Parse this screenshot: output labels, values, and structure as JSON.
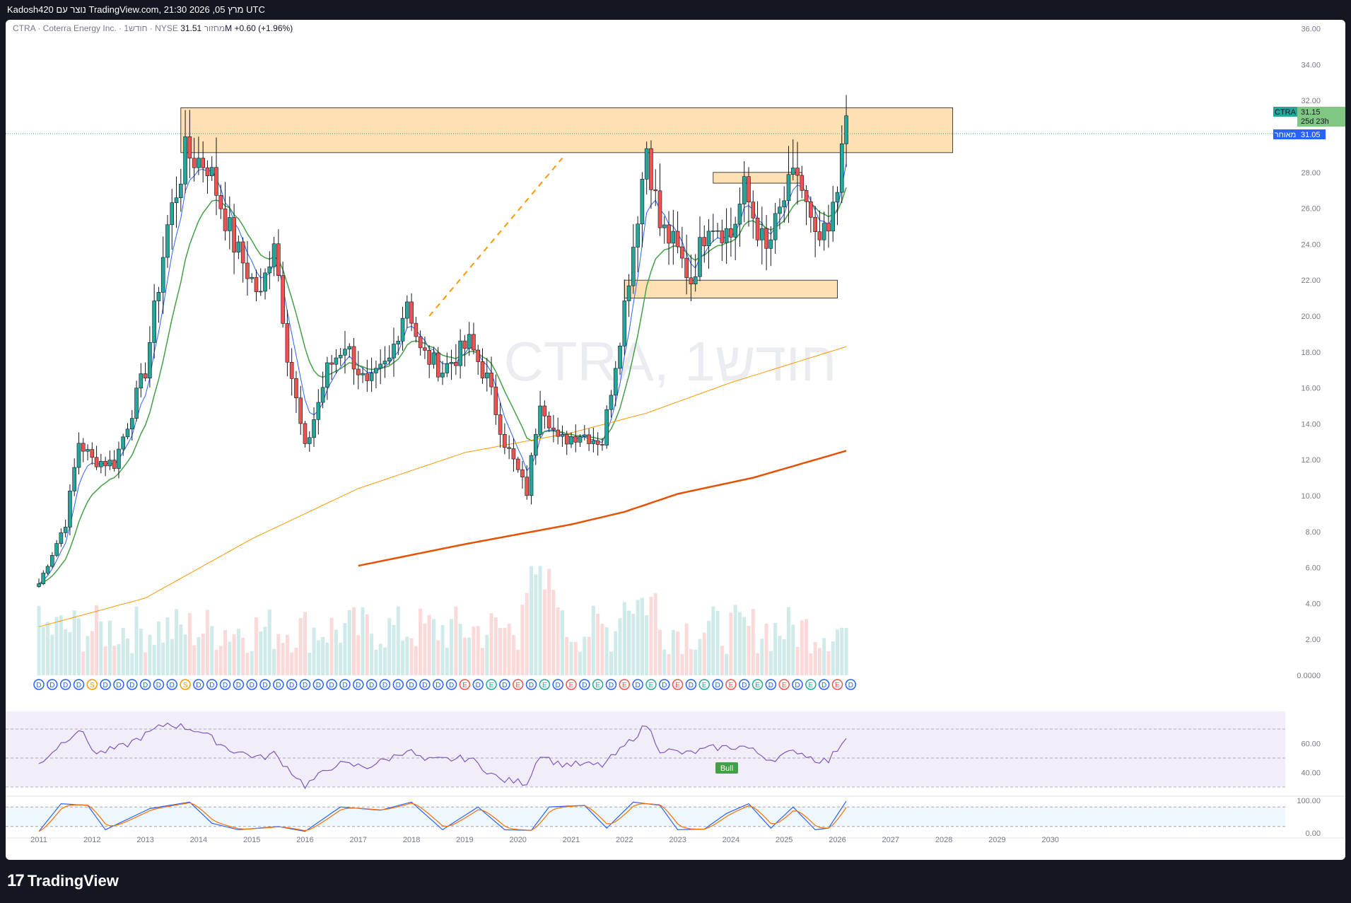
{
  "header": {
    "caption": "Kadosh420 נוצר עם TradingView.com, 21:30 2026 ,05 מרץ UTC"
  },
  "legend": {
    "symbol_line": "CTRA · Coterra Energy Inc. · 1חודש · NYSE",
    "volume_label": "מחזור",
    "volume_value": "31.51M",
    "change": "+0.60 (+1.96%)"
  },
  "watermark": "CTRA, 1חודש",
  "price_tag": {
    "symbol": "CTRA",
    "price": "31.15",
    "countdown": "25d 23h",
    "prev_label": "מאוחר",
    "prev_value": "31.05"
  },
  "rsi_label": "Bull",
  "footer": {
    "brand": "TradingView",
    "logo": "17"
  },
  "colors": {
    "up": "#26a69a",
    "down": "#ef5350",
    "zone": "#ffe0b2",
    "ema_fast": "#2962ff",
    "ema_mid": "#43a047",
    "sma_long": "#ff9800",
    "sma_200": "#e65100",
    "rsi": "#7e57c2",
    "stoch_k": "#2962ff",
    "stoch_d": "#ff6d00"
  },
  "chart_data": {
    "type": "candlestick",
    "timeframe": "1M",
    "y_axis_ticks": [
      "36.00",
      "34.00",
      "32.00",
      "30.00",
      "28.00",
      "26.00",
      "24.00",
      "22.00",
      "20.00",
      "18.00",
      "16.00",
      "14.00",
      "12.00",
      "10.00",
      "8.00",
      "6.00",
      "4.00",
      "2.00",
      "0.0000"
    ],
    "rsi_axis_ticks": [
      "60.00",
      "40.00"
    ],
    "stoch_axis_ticks": [
      "100.00",
      "0.00"
    ],
    "x_axis_ticks": [
      "2011",
      "2012",
      "2013",
      "2014",
      "2015",
      "2016",
      "2017",
      "2018",
      "2019",
      "2020",
      "2021",
      "2022",
      "2023",
      "2024",
      "2025",
      "2026",
      "2027",
      "2028",
      "2029",
      "2030"
    ],
    "ylim": [
      0,
      36
    ],
    "closes_anchor": [
      {
        "x": "2011-01",
        "y": 5.1
      },
      {
        "x": "2011-07",
        "y": 8.5
      },
      {
        "x": "2011-10",
        "y": 13
      },
      {
        "x": "2012-01",
        "y": 12
      },
      {
        "x": "2012-06",
        "y": 11.8
      },
      {
        "x": "2013-01",
        "y": 17
      },
      {
        "x": "2013-06",
        "y": 25
      },
      {
        "x": "2013-10",
        "y": 29
      },
      {
        "x": "2014-03",
        "y": 28.5
      },
      {
        "x": "2014-09",
        "y": 24
      },
      {
        "x": "2015-03",
        "y": 21
      },
      {
        "x": "2015-06",
        "y": 24.5
      },
      {
        "x": "2015-09",
        "y": 18
      },
      {
        "x": "2016-01",
        "y": 12.5
      },
      {
        "x": "2016-06",
        "y": 17
      },
      {
        "x": "2016-10",
        "y": 18.5
      },
      {
        "x": "2017-03",
        "y": 16
      },
      {
        "x": "2017-08",
        "y": 17.5
      },
      {
        "x": "2017-12",
        "y": 21
      },
      {
        "x": "2018-03",
        "y": 18
      },
      {
        "x": "2018-08",
        "y": 17
      },
      {
        "x": "2019-02",
        "y": 18.5
      },
      {
        "x": "2019-06",
        "y": 16.5
      },
      {
        "x": "2019-10",
        "y": 13
      },
      {
        "x": "2020-03",
        "y": 10.2
      },
      {
        "x": "2020-06",
        "y": 15.5
      },
      {
        "x": "2020-10",
        "y": 13
      },
      {
        "x": "2021-03",
        "y": 13.5
      },
      {
        "x": "2021-08",
        "y": 13
      },
      {
        "x": "2021-12",
        "y": 19
      },
      {
        "x": "2022-03",
        "y": 24
      },
      {
        "x": "2022-06",
        "y": 29.5
      },
      {
        "x": "2022-09",
        "y": 25
      },
      {
        "x": "2022-12",
        "y": 24
      },
      {
        "x": "2023-04",
        "y": 22
      },
      {
        "x": "2023-08",
        "y": 25.5
      },
      {
        "x": "2024-01",
        "y": 24.5
      },
      {
        "x": "2024-04",
        "y": 27
      },
      {
        "x": "2024-09",
        "y": 23.5
      },
      {
        "x": "2025-01",
        "y": 26.5
      },
      {
        "x": "2025-04",
        "y": 28
      },
      {
        "x": "2025-08",
        "y": 24
      },
      {
        "x": "2025-11",
        "y": 24.5
      },
      {
        "x": "2026-01",
        "y": 27
      },
      {
        "x": "2026-02",
        "y": 30.5
      },
      {
        "x": "2026-03",
        "y": 31.15
      }
    ],
    "sma_long_anchor": [
      {
        "x": "2011-01",
        "y": 2.7
      },
      {
        "x": "2013-01",
        "y": 4.3
      },
      {
        "x": "2015-01",
        "y": 7.6
      },
      {
        "x": "2017-01",
        "y": 10.4
      },
      {
        "x": "2019-01",
        "y": 12.4
      },
      {
        "x": "2021-01",
        "y": 13.5
      },
      {
        "x": "2022-06",
        "y": 14.6
      },
      {
        "x": "2024-01",
        "y": 16.3
      },
      {
        "x": "2026-03",
        "y": 18.3
      }
    ],
    "sma_200_anchor": [
      {
        "x": "2017-01",
        "y": 6.1
      },
      {
        "x": "2019-01",
        "y": 7.3
      },
      {
        "x": "2021-01",
        "y": 8.4
      },
      {
        "x": "2022-01",
        "y": 9.1
      },
      {
        "x": "2023-01",
        "y": 10.1
      },
      {
        "x": "2024-06",
        "y": 11.0
      },
      {
        "x": "2026-03",
        "y": 12.5
      }
    ],
    "zones": [
      {
        "from": "2013-09",
        "to": "2028-03",
        "low": 29.1,
        "high": 31.6
      },
      {
        "from": "2023-09",
        "to": "2025-05",
        "low": 27.4,
        "high": 28.0
      },
      {
        "from": "2022-01",
        "to": "2026-01",
        "low": 21.0,
        "high": 22.0
      }
    ],
    "trend_line": {
      "from": {
        "x": "2018-05",
        "y": 20.0
      },
      "to": {
        "x": "2020-11",
        "y": 28.8
      }
    },
    "rsi_anchor": [
      {
        "x": "2011-01",
        "y": 46
      },
      {
        "x": "2011-06",
        "y": 60
      },
      {
        "x": "2011-10",
        "y": 70
      },
      {
        "x": "2012-02",
        "y": 53
      },
      {
        "x": "2012-08",
        "y": 58
      },
      {
        "x": "2013-06",
        "y": 74
      },
      {
        "x": "2014-01",
        "y": 69
      },
      {
        "x": "2014-08",
        "y": 56
      },
      {
        "x": "2015-03",
        "y": 50
      },
      {
        "x": "2015-06",
        "y": 53
      },
      {
        "x": "2016-01",
        "y": 31
      },
      {
        "x": "2016-08",
        "y": 46
      },
      {
        "x": "2017-03",
        "y": 44
      },
      {
        "x": "2017-09",
        "y": 51
      },
      {
        "x": "2017-12",
        "y": 56
      },
      {
        "x": "2018-04",
        "y": 48
      },
      {
        "x": "2019-02",
        "y": 50
      },
      {
        "x": "2019-09",
        "y": 35
      },
      {
        "x": "2020-03",
        "y": 33
      },
      {
        "x": "2020-06",
        "y": 53
      },
      {
        "x": "2020-10",
        "y": 46
      },
      {
        "x": "2021-08",
        "y": 45
      },
      {
        "x": "2021-12",
        "y": 55
      },
      {
        "x": "2022-06",
        "y": 73
      },
      {
        "x": "2022-09",
        "y": 56
      },
      {
        "x": "2023-03",
        "y": 53
      },
      {
        "x": "2023-09",
        "y": 57
      },
      {
        "x": "2024-04",
        "y": 58
      },
      {
        "x": "2024-10",
        "y": 49
      },
      {
        "x": "2025-04",
        "y": 55
      },
      {
        "x": "2025-08",
        "y": 49
      },
      {
        "x": "2025-11",
        "y": 48
      },
      {
        "x": "2026-03",
        "y": 65
      }
    ],
    "stoch_k_anchor": [
      {
        "x": "2011-01",
        "y": 5
      },
      {
        "x": "2011-06",
        "y": 90
      },
      {
        "x": "2011-12",
        "y": 85
      },
      {
        "x": "2012-04",
        "y": 10
      },
      {
        "x": "2013-02",
        "y": 75
      },
      {
        "x": "2013-11",
        "y": 95
      },
      {
        "x": "2014-04",
        "y": 30
      },
      {
        "x": "2014-10",
        "y": 10
      },
      {
        "x": "2015-07",
        "y": 20
      },
      {
        "x": "2016-01",
        "y": 5
      },
      {
        "x": "2016-09",
        "y": 80
      },
      {
        "x": "2017-06",
        "y": 70
      },
      {
        "x": "2018-01",
        "y": 95
      },
      {
        "x": "2018-08",
        "y": 10
      },
      {
        "x": "2019-04",
        "y": 80
      },
      {
        "x": "2019-10",
        "y": 10
      },
      {
        "x": "2020-04",
        "y": 8
      },
      {
        "x": "2020-08",
        "y": 80
      },
      {
        "x": "2021-04",
        "y": 85
      },
      {
        "x": "2021-09",
        "y": 15
      },
      {
        "x": "2022-03",
        "y": 95
      },
      {
        "x": "2022-09",
        "y": 85
      },
      {
        "x": "2023-01",
        "y": 10
      },
      {
        "x": "2023-07",
        "y": 12
      },
      {
        "x": "2023-12",
        "y": 60
      },
      {
        "x": "2024-05",
        "y": 90
      },
      {
        "x": "2024-10",
        "y": 15
      },
      {
        "x": "2025-03",
        "y": 80
      },
      {
        "x": "2025-08",
        "y": 10
      },
      {
        "x": "2025-11",
        "y": 15
      },
      {
        "x": "2026-03",
        "y": 98
      }
    ],
    "markers": {
      "dividends_row_label": "D",
      "special_label": "S",
      "earnings_label": "E"
    }
  }
}
